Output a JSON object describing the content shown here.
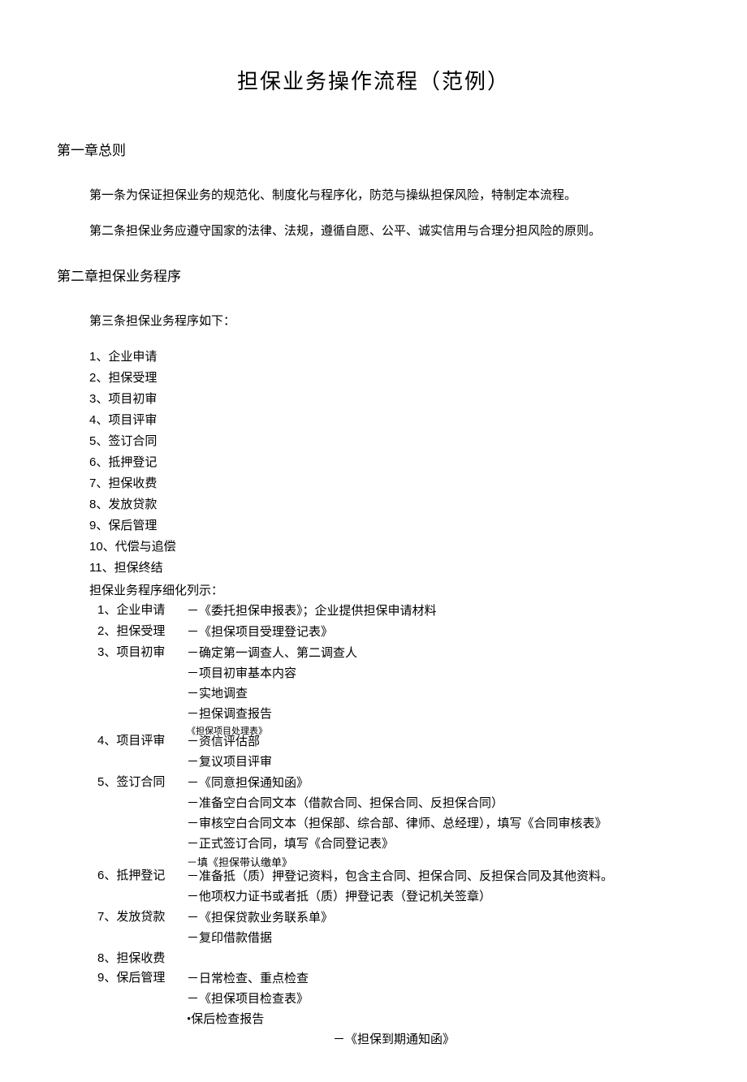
{
  "title": "担保业务操作流程（范例）",
  "chapter1": {
    "heading": "第一章总则",
    "article1": "第一条为保证担保业务的规范化、制度化与程序化，防范与操纵担保风险，特制定本流程。",
    "article2": "第二条担保业务应遵守国家的法律、法规，遵循自愿、公平、诚实信用与合理分担风险的原则。"
  },
  "chapter2": {
    "heading": "第二章担保业务程序",
    "article3_intro": "第三条担保业务程序如下：",
    "steps": [
      "1、企业申请",
      "2、担保受理",
      "3、项目初审",
      "4、项目评审",
      "5、签订合同",
      "6、抵押登记",
      "7、担保收费",
      "8、发放贷款",
      "9、保后管理",
      "10、代偿与追偿",
      "11、担保终结"
    ],
    "detail_intro": "担保业务程序细化列示：",
    "details": [
      {
        "label": "1、企业申请",
        "lines": [
          "－《委托担保申报表》；企业提供担保申请材料"
        ]
      },
      {
        "label": "2、担保受理",
        "lines": [
          "－《担保项目受理登记表》"
        ]
      },
      {
        "label": "3、项目初审",
        "lines": [
          "－确定第一调查人、第二调查人",
          "－项目初审基本内容",
          "－实地调查",
          "－担保调查报告",
          "《担保项目处理表》"
        ]
      },
      {
        "label": "4、项目评审",
        "lines": [
          "－资信评估部",
          "－复议项目评审"
        ]
      },
      {
        "label": "5、签订合同",
        "lines": [
          "－《同意担保通知函》",
          "－准备空白合同文本（借款合同、担保合同、反担保合同）",
          "－审核空白合同文本（担保部、综合部、律师、总经理），填写《合同审核表》",
          "－正式签订合同，填写《合同登记表》",
          "－填《担保带认缴单》"
        ]
      },
      {
        "label": "6、抵押登记",
        "lines": [
          "－准备抵（质）押登记资料，包含主合同、担保合同、反担保合同及其他资料。",
          "－他项权力证书或者抵（质）押登记表（登记机关签章）"
        ]
      },
      {
        "label": "7、发放贷款",
        "lines": [
          "－《担保贷款业务联系单》",
          "－复印借款借据"
        ]
      },
      {
        "label": "8、担保收费",
        "lines": []
      },
      {
        "label": "9、保后管理",
        "lines": [
          "－日常检查、重点检查",
          "－《担保项目检查表》",
          "•保后检查报告"
        ]
      }
    ],
    "final_line": "－《担保到期通知函》"
  }
}
